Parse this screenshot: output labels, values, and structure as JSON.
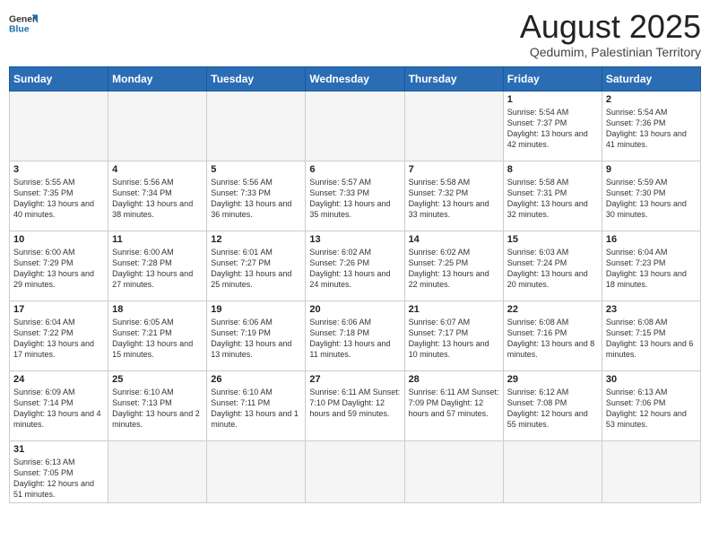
{
  "header": {
    "logo_text_general": "General",
    "logo_text_blue": "Blue",
    "title": "August 2025",
    "subtitle": "Qedumim, Palestinian Territory"
  },
  "weekdays": [
    "Sunday",
    "Monday",
    "Tuesday",
    "Wednesday",
    "Thursday",
    "Friday",
    "Saturday"
  ],
  "weeks": [
    [
      {
        "day": "",
        "info": ""
      },
      {
        "day": "",
        "info": ""
      },
      {
        "day": "",
        "info": ""
      },
      {
        "day": "",
        "info": ""
      },
      {
        "day": "",
        "info": ""
      },
      {
        "day": "1",
        "info": "Sunrise: 5:54 AM\nSunset: 7:37 PM\nDaylight: 13 hours\nand 42 minutes."
      },
      {
        "day": "2",
        "info": "Sunrise: 5:54 AM\nSunset: 7:36 PM\nDaylight: 13 hours\nand 41 minutes."
      }
    ],
    [
      {
        "day": "3",
        "info": "Sunrise: 5:55 AM\nSunset: 7:35 PM\nDaylight: 13 hours\nand 40 minutes."
      },
      {
        "day": "4",
        "info": "Sunrise: 5:56 AM\nSunset: 7:34 PM\nDaylight: 13 hours\nand 38 minutes."
      },
      {
        "day": "5",
        "info": "Sunrise: 5:56 AM\nSunset: 7:33 PM\nDaylight: 13 hours\nand 36 minutes."
      },
      {
        "day": "6",
        "info": "Sunrise: 5:57 AM\nSunset: 7:33 PM\nDaylight: 13 hours\nand 35 minutes."
      },
      {
        "day": "7",
        "info": "Sunrise: 5:58 AM\nSunset: 7:32 PM\nDaylight: 13 hours\nand 33 minutes."
      },
      {
        "day": "8",
        "info": "Sunrise: 5:58 AM\nSunset: 7:31 PM\nDaylight: 13 hours\nand 32 minutes."
      },
      {
        "day": "9",
        "info": "Sunrise: 5:59 AM\nSunset: 7:30 PM\nDaylight: 13 hours\nand 30 minutes."
      }
    ],
    [
      {
        "day": "10",
        "info": "Sunrise: 6:00 AM\nSunset: 7:29 PM\nDaylight: 13 hours\nand 29 minutes."
      },
      {
        "day": "11",
        "info": "Sunrise: 6:00 AM\nSunset: 7:28 PM\nDaylight: 13 hours\nand 27 minutes."
      },
      {
        "day": "12",
        "info": "Sunrise: 6:01 AM\nSunset: 7:27 PM\nDaylight: 13 hours\nand 25 minutes."
      },
      {
        "day": "13",
        "info": "Sunrise: 6:02 AM\nSunset: 7:26 PM\nDaylight: 13 hours\nand 24 minutes."
      },
      {
        "day": "14",
        "info": "Sunrise: 6:02 AM\nSunset: 7:25 PM\nDaylight: 13 hours\nand 22 minutes."
      },
      {
        "day": "15",
        "info": "Sunrise: 6:03 AM\nSunset: 7:24 PM\nDaylight: 13 hours\nand 20 minutes."
      },
      {
        "day": "16",
        "info": "Sunrise: 6:04 AM\nSunset: 7:23 PM\nDaylight: 13 hours\nand 18 minutes."
      }
    ],
    [
      {
        "day": "17",
        "info": "Sunrise: 6:04 AM\nSunset: 7:22 PM\nDaylight: 13 hours\nand 17 minutes."
      },
      {
        "day": "18",
        "info": "Sunrise: 6:05 AM\nSunset: 7:21 PM\nDaylight: 13 hours\nand 15 minutes."
      },
      {
        "day": "19",
        "info": "Sunrise: 6:06 AM\nSunset: 7:19 PM\nDaylight: 13 hours\nand 13 minutes."
      },
      {
        "day": "20",
        "info": "Sunrise: 6:06 AM\nSunset: 7:18 PM\nDaylight: 13 hours\nand 11 minutes."
      },
      {
        "day": "21",
        "info": "Sunrise: 6:07 AM\nSunset: 7:17 PM\nDaylight: 13 hours\nand 10 minutes."
      },
      {
        "day": "22",
        "info": "Sunrise: 6:08 AM\nSunset: 7:16 PM\nDaylight: 13 hours\nand 8 minutes."
      },
      {
        "day": "23",
        "info": "Sunrise: 6:08 AM\nSunset: 7:15 PM\nDaylight: 13 hours\nand 6 minutes."
      }
    ],
    [
      {
        "day": "24",
        "info": "Sunrise: 6:09 AM\nSunset: 7:14 PM\nDaylight: 13 hours\nand 4 minutes."
      },
      {
        "day": "25",
        "info": "Sunrise: 6:10 AM\nSunset: 7:13 PM\nDaylight: 13 hours\nand 2 minutes."
      },
      {
        "day": "26",
        "info": "Sunrise: 6:10 AM\nSunset: 7:11 PM\nDaylight: 13 hours\nand 1 minute."
      },
      {
        "day": "27",
        "info": "Sunrise: 6:11 AM\nSunset: 7:10 PM\nDaylight: 12 hours\nand 59 minutes."
      },
      {
        "day": "28",
        "info": "Sunrise: 6:11 AM\nSunset: 7:09 PM\nDaylight: 12 hours\nand 57 minutes."
      },
      {
        "day": "29",
        "info": "Sunrise: 6:12 AM\nSunset: 7:08 PM\nDaylight: 12 hours\nand 55 minutes."
      },
      {
        "day": "30",
        "info": "Sunrise: 6:13 AM\nSunset: 7:06 PM\nDaylight: 12 hours\nand 53 minutes."
      }
    ],
    [
      {
        "day": "31",
        "info": "Sunrise: 6:13 AM\nSunset: 7:05 PM\nDaylight: 12 hours\nand 51 minutes."
      },
      {
        "day": "",
        "info": ""
      },
      {
        "day": "",
        "info": ""
      },
      {
        "day": "",
        "info": ""
      },
      {
        "day": "",
        "info": ""
      },
      {
        "day": "",
        "info": ""
      },
      {
        "day": "",
        "info": ""
      }
    ]
  ]
}
